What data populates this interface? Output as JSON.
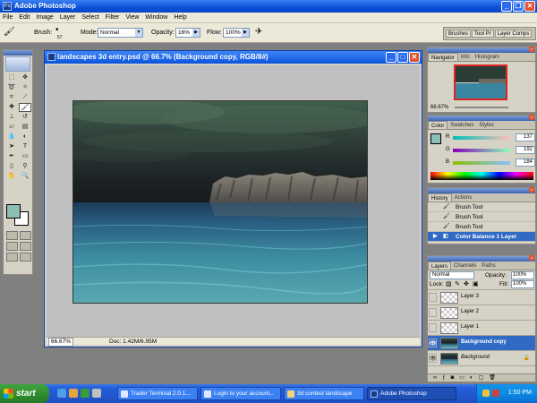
{
  "app": {
    "title": "Adobe Photoshop",
    "icon": "photoshop-app-icon"
  },
  "menu": [
    "File",
    "Edit",
    "Image",
    "Layer",
    "Select",
    "Filter",
    "View",
    "Window",
    "Help"
  ],
  "options": {
    "brush_label": "Brush:",
    "brush_size": "57",
    "mode_label": "Mode:",
    "mode_value": "Normal",
    "opacity_label": "Opacity:",
    "opacity_value": "16%",
    "flow_label": "Flow:",
    "flow_value": "100%",
    "wells": [
      "Brushes",
      "Tool Pr",
      "Layer Comps"
    ]
  },
  "document": {
    "title": "landscapes 3d entry.psd @ 66.7% (Background copy, RGB/8#)",
    "zoom": "66.67%",
    "doc_size": "Doc: 1.42M/6.95M"
  },
  "navigator": {
    "tabs": [
      "Navigator",
      "Info",
      "Histogram"
    ],
    "zoom": "66.67%"
  },
  "color": {
    "tabs": [
      "Color",
      "Swatches",
      "Styles"
    ],
    "r_label": "R",
    "r_value": "137",
    "g_label": "G",
    "g_value": "192",
    "b_label": "B",
    "b_value": "184",
    "foreground": "#89c0b8"
  },
  "history": {
    "tabs": [
      "History",
      "Actions"
    ],
    "items": [
      "Brush Tool",
      "Brush Tool",
      "Brush Tool",
      "Color Balance 1 Layer"
    ]
  },
  "layers": {
    "tabs": [
      "Layers",
      "Channels",
      "Paths"
    ],
    "blend_mode": "Normal",
    "opacity_label": "Opacity:",
    "opacity_value": "100%",
    "lock_label": "Lock:",
    "fill_label": "Fill:",
    "fill_value": "100%",
    "items": [
      "Layer 3",
      "Layer 2",
      "Layer 1",
      "Background copy",
      "Background"
    ]
  },
  "taskbar": {
    "start": "start",
    "tasks": [
      "Trader Terminal 2.0.1...",
      "Login to your account...",
      "3d contest landscape",
      "Adobe Photoshop"
    ],
    "clock": "1:50 PM"
  }
}
